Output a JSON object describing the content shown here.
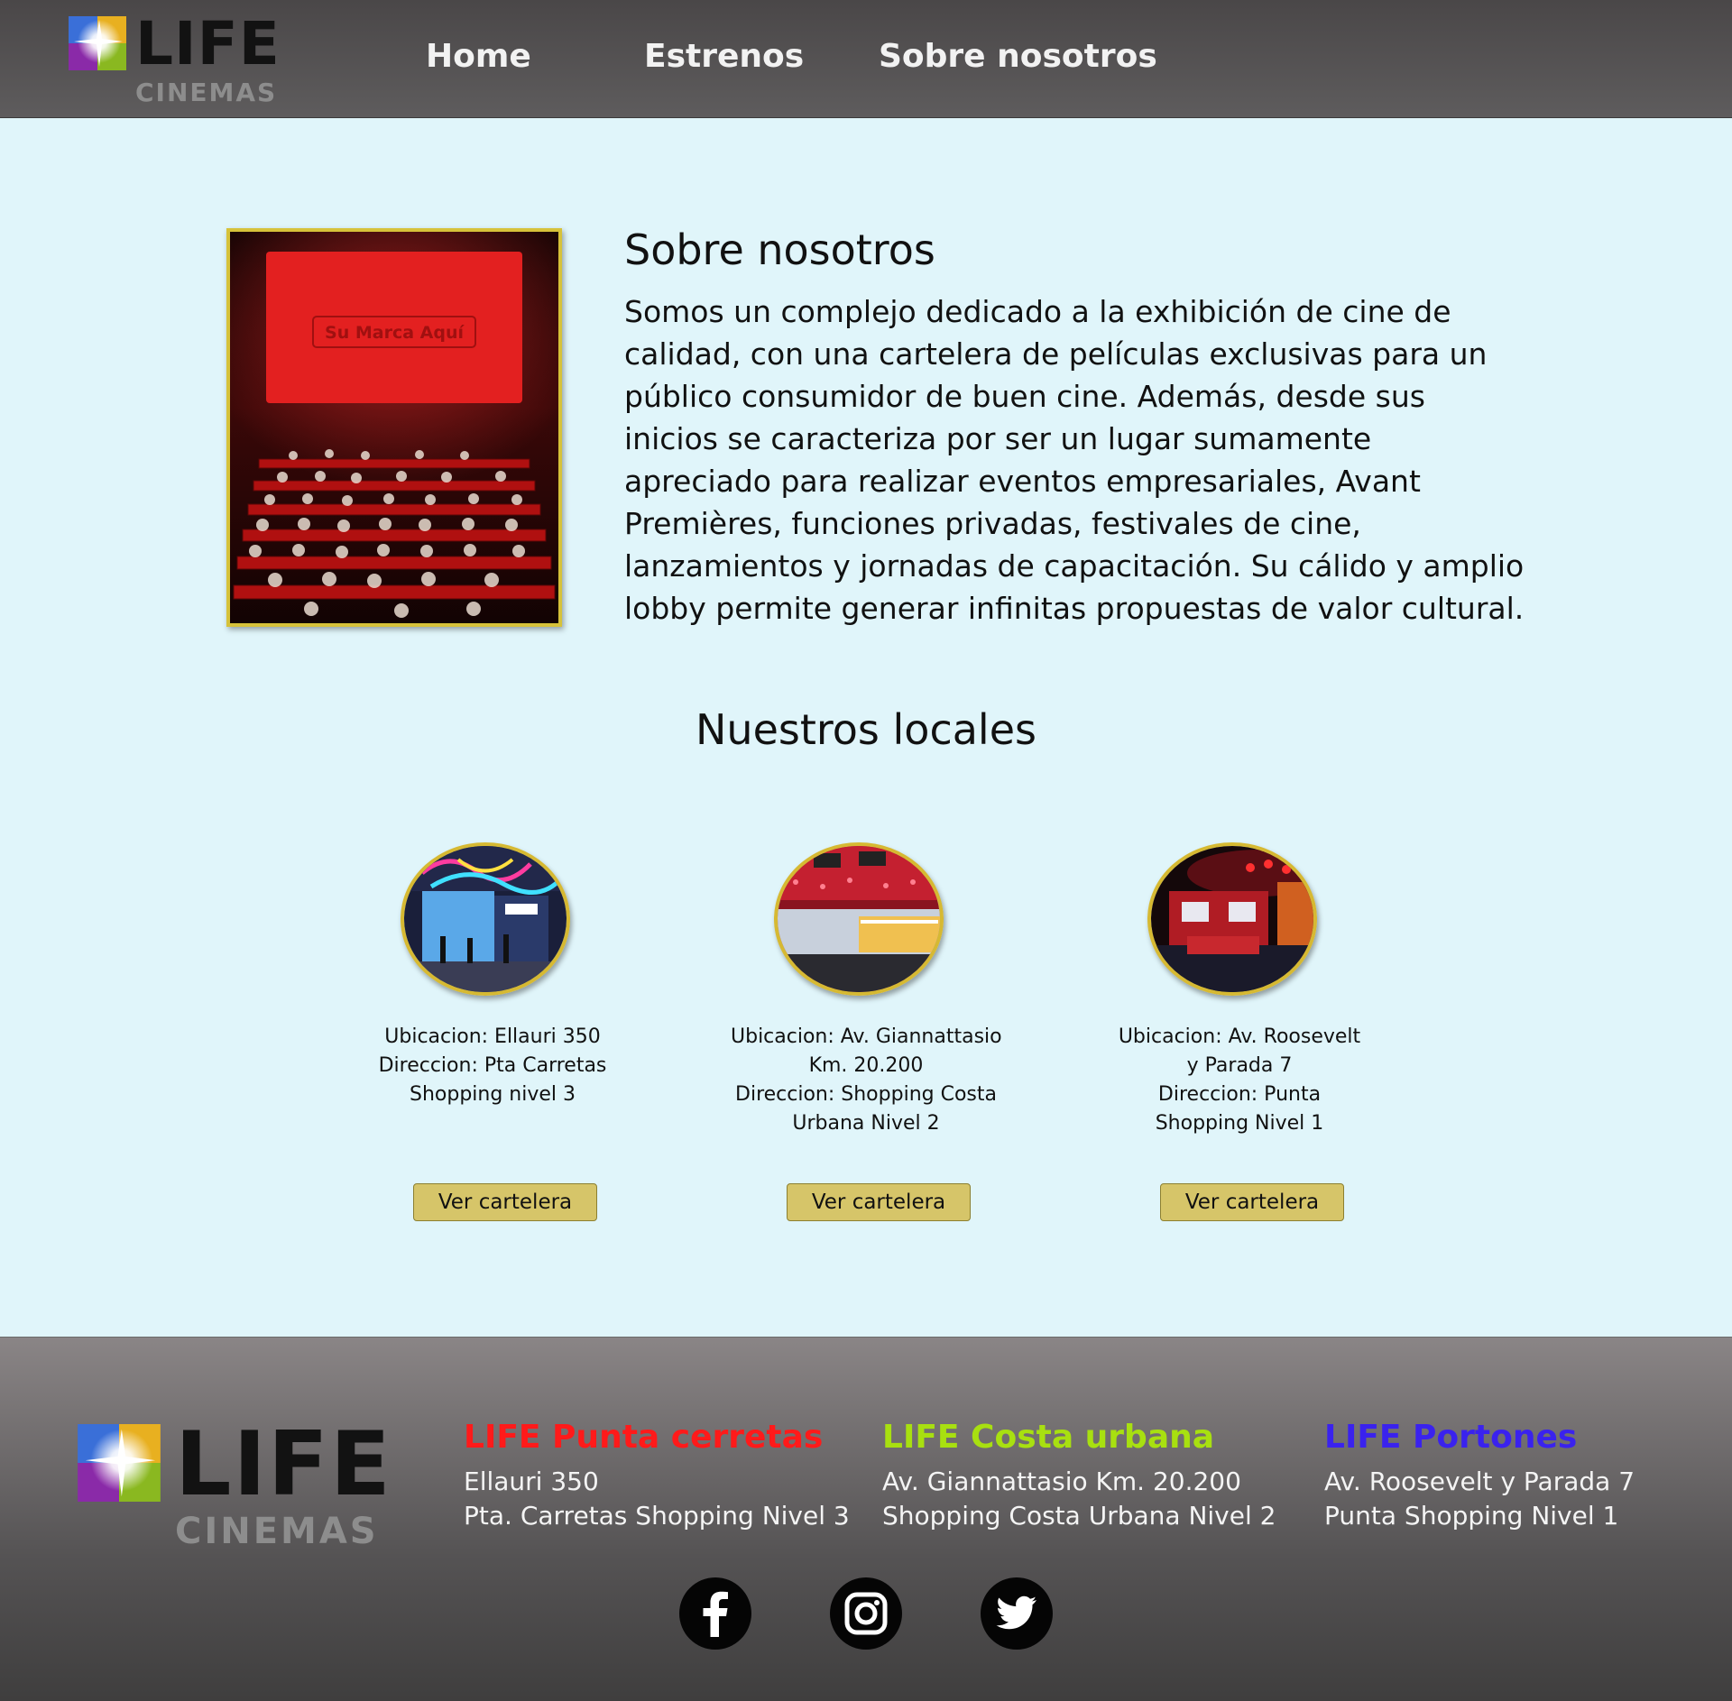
{
  "header": {
    "logo": {
      "word": "LIFE",
      "sub": "CINEMAS"
    },
    "nav": [
      {
        "label": "Home"
      },
      {
        "label": "Estrenos"
      },
      {
        "label": "Sobre nosotros"
      }
    ]
  },
  "about": {
    "photo_screen_text": "Su Marca Aquí",
    "title": "Sobre nosotros",
    "text": "Somos un complejo dedicado a la exhibición de cine de calidad, con una cartelera de películas exclusivas para un público consumidor de buen cine. Además, desde sus inicios se caracteriza por ser un lugar sumamente apreciado para realizar eventos empresariales, Avant Premières, funciones privadas, festivales de cine, lanzamientos y jornadas de capacitación. Su cálido y amplio lobby permite generar infinitas propuestas de valor cultural."
  },
  "locales": {
    "title": "Nuestros locales",
    "cards": [
      {
        "lines": [
          "Ubicacion: Ellauri 350",
          "Direccion: Pta Carretas",
          "Shopping nivel 3"
        ],
        "button": "Ver cartelera"
      },
      {
        "lines": [
          "Ubicacion: Av. Giannattasio",
          "Km. 20.200",
          "Direccion: Shopping Costa",
          "Urbana Nivel 2"
        ],
        "button": "Ver cartelera"
      },
      {
        "lines": [
          "Ubicacion: Av. Roosevelt",
          "y Parada 7",
          "Direccion: Punta",
          "Shopping Nivel 1"
        ],
        "button": "Ver cartelera"
      }
    ]
  },
  "footer": {
    "logo": {
      "word": "LIFE",
      "sub": "CINEMAS"
    },
    "branches": [
      {
        "name": "LIFE Punta cerretas",
        "color": "#ff1a1a",
        "lines": [
          "Ellauri 350",
          "Pta. Carretas Shopping Nivel 3"
        ]
      },
      {
        "name": "LIFE Costa urbana",
        "color": "#a8e010",
        "lines": [
          "Av. Giannattasio Km. 20.200",
          "Shopping Costa Urbana Nivel 2"
        ]
      },
      {
        "name": "LIFE Portones",
        "color": "#3a22ee",
        "lines": [
          "Av. Roosevelt y Parada 7",
          "Punta Shopping Nivel 1"
        ]
      }
    ],
    "social": [
      {
        "icon": "facebook-icon"
      },
      {
        "icon": "instagram-icon"
      },
      {
        "icon": "twitter-icon"
      }
    ]
  },
  "colors": {
    "page_bg": "#e0f5fa",
    "header_bg": "#4a4748",
    "gold_border": "#d6c23a",
    "button_bg": "#d6c569"
  }
}
